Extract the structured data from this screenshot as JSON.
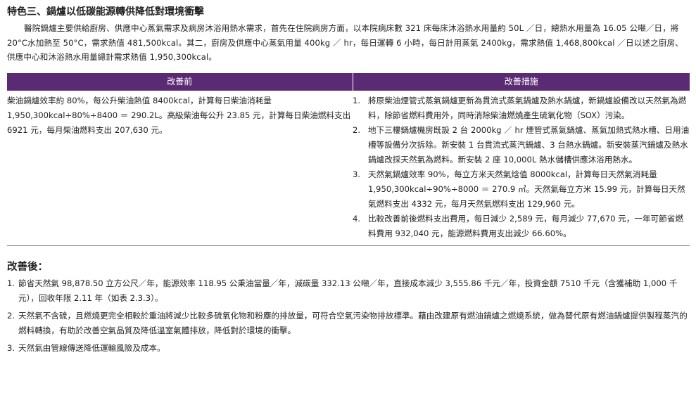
{
  "section": {
    "title": "特色三、鍋爐以低碳能源轉供降低對環境衝擊",
    "intro": "醫院鍋爐主要供給廚房、供應中心蒸氣需求及病房沐浴用熱水需求，首先在住院病房方面，以本院病床數 321 床每床沐浴熱水用量約 50L ／日，總熱水用量為 16.05 公噸／日，將 20°C水加熱至 50°C，需求熱值 481,500kcal。其二，廚房及供應中心蒸氣用量 400kg ／ hr，每日運轉 6 小時，每日計用蒸氣 2400kg，需求熱值 1,468,800kcal ／日以述之廚房、供應中心和沐浴熱水用量總計需求熱值 1,950,300kcal。"
  },
  "table": {
    "header_before": "改善前",
    "header_after": "改善措施",
    "before_text": "柴油鍋爐效率約 80%，每公升柴油熱值 8400kcal，計算每日柴油消耗量 1,950,300kcal÷80%÷8400 ＝ 290.2L。高級柴油每公升 23.85 元，計算每日柴油燃料支出 6921 元，每月柴油燃料支出 207,630 元。",
    "measures": [
      {
        "num": "1.",
        "text": "將原柴油煙管式蒸氣鍋爐更新為貫流式蒸氣鍋爐及熱水鍋爐，新鍋爐設備改以天然氣為燃料，除節省燃料費用外，同時消除柴油燃燒產生硫氧化物（SOX）污染。"
      },
      {
        "num": "2.",
        "text": "地下三樓鍋爐機房既設 2 台 2000kg ／ hr 煙管式蒸氣鍋爐、蒸氣加熱式熱水槽、日用油槽等設備分次拆除。新安裝 1 台貫流式蒸汽鍋爐、3 台熱水鍋爐。新安裝蒸汽鍋爐及熱水鍋爐改採天然氣為燃料。新安裝 2 座 10,000L 熱水儲槽供應沐浴用熱水。"
      },
      {
        "num": "3.",
        "text": "天然氣鍋爐效率 90%，每立方米天然氣焓值 8000kcal，計算每日天然氣消耗量 1,950,300kcal÷90%÷8000 ＝ 270.9 ㎥。天然氣每立方米 15.99 元，計算每日天然氣燃料支出 4332 元，每月天然氣燃料支出 129,960 元。"
      },
      {
        "num": "4.",
        "text": "比較改善前後燃料支出費用，每日減少 2,589 元，每月減少 77,670 元，一年可節省燃料費用 932,040 元，能源燃料費用支出減少 66.60%。"
      }
    ]
  },
  "after": {
    "title": "改善後：",
    "items": [
      {
        "num": "1.",
        "text": "節省天然氣 98,878.50 立方公尺／年，能源效率 118.95 公秉油當量／年，減碳量 332.13 公噸／年，直接成本減少 3,555.86 千元／年，投資金額 7510 千元（含獲補助 1,000 千元），回收年限 2.11 年（如表 2.3.3）。"
      },
      {
        "num": "2.",
        "text": "天然氣不含硫，且燃燒更完全相較於重油將減少比較多硫氧化物和粉塵的排放量，可符合空氣污染物排放標準。藉由改建原有燃油鍋爐之燃燒系統，做為替代原有燃油鍋爐提供製程蒸汽的燃料轉換，有助於改善空氣品質及降低溫室氣體排放，降低對於環境的衝擊。"
      },
      {
        "num": "3.",
        "text": "天然氣由管線傳送降低運輸風險及成本。"
      }
    ]
  },
  "colors": {
    "header_bg": "#5b2a74",
    "header_text": "#ffffff",
    "rule": "#8a8a8a"
  }
}
